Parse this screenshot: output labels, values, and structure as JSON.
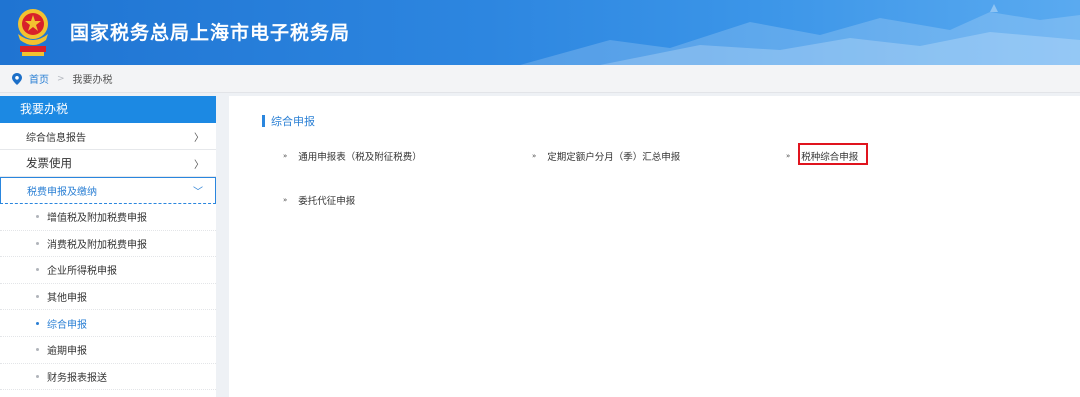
{
  "header": {
    "title": "国家税务总局上海市电子税务局",
    "emblem_icon": "tax-emblem-icon"
  },
  "breadcrumb": {
    "home": "首页",
    "separator": ">",
    "current": "我要办税"
  },
  "sidebar": {
    "heading": "我要办税",
    "items": [
      {
        "label": "综合信息报告",
        "arrow": "〉"
      },
      {
        "label": "发票使用",
        "arrow": "〉"
      },
      {
        "label": "税费申报及缴纳",
        "arrow": "﹀"
      }
    ],
    "sub_items": [
      {
        "label": "增值税及附加税费申报"
      },
      {
        "label": "消费税及附加税费申报"
      },
      {
        "label": "企业所得税申报"
      },
      {
        "label": "其他申报"
      },
      {
        "label": "综合申报"
      },
      {
        "label": "逾期申报"
      },
      {
        "label": "财务报表报送"
      }
    ]
  },
  "main": {
    "section_title": "综合申报",
    "bullet": "»",
    "entries": [
      {
        "label": "通用申报表（税及附征税费）"
      },
      {
        "label": "定期定额户分月（季）汇总申报"
      },
      {
        "label": "税种综合申报"
      },
      {
        "label": "委托代征申报"
      }
    ]
  },
  "colors": {
    "accent": "#1c89e3",
    "highlight_border": "#e0141e"
  }
}
